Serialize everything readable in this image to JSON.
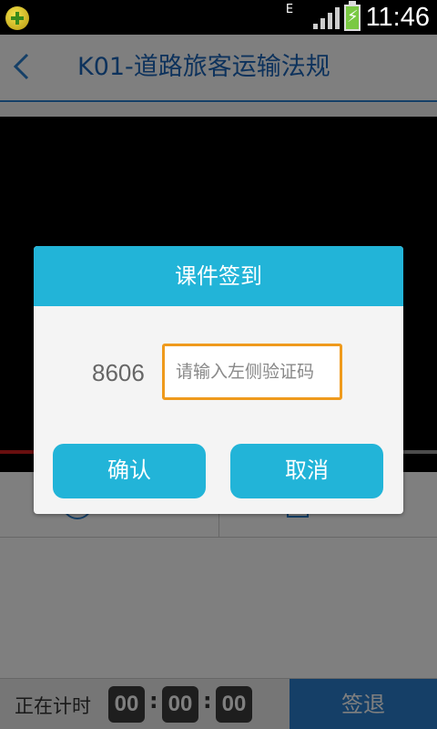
{
  "status_bar": {
    "app_icon": "plus-coin-icon",
    "network": "E",
    "time": "11:46"
  },
  "header": {
    "back_icon": "chevron-left-icon",
    "title": "K01-道路旅客运输法规"
  },
  "video": {
    "progress": 0.08
  },
  "bottom_bar": {
    "timer_label": "正在计时",
    "timer": [
      "00",
      "00",
      "00"
    ],
    "separator": ":",
    "signout_label": "签退"
  },
  "dialog": {
    "title": "课件签到",
    "code": "8606",
    "input_value": "",
    "input_placeholder": "请输入左侧验证码",
    "confirm_label": "确认",
    "cancel_label": "取消"
  },
  "colors": {
    "accent": "#22b4d8",
    "brand_blue": "#2a7fcf",
    "input_focus": "#ef9a1c"
  }
}
